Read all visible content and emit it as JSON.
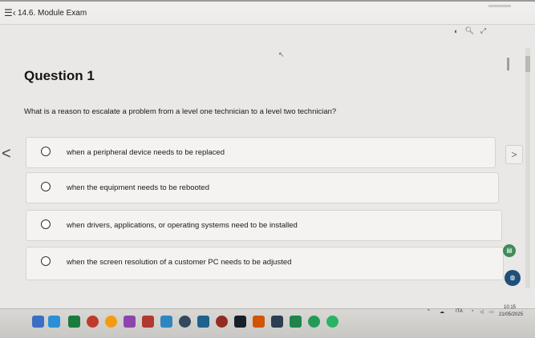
{
  "header": {
    "menu_icon": "menu-list-icon",
    "module_title": "14.6. Module Exam"
  },
  "toolbar": {
    "icons": [
      "moon-icon",
      "search-icon",
      "expand-icon"
    ]
  },
  "question": {
    "heading": "Question 1",
    "text": "What is a reason to escalate a problem from a level one technician to a level two technician?"
  },
  "options": [
    {
      "label": "when a peripheral device needs to be replaced",
      "selected": false
    },
    {
      "label": "when the equipment needs to be rebooted",
      "selected": false
    },
    {
      "label": "when drivers, applications, or operating systems need to be installed",
      "selected": false
    },
    {
      "label": "when the screen resolution of a customer PC needs to be adjusted",
      "selected": false
    }
  ],
  "navigation": {
    "prev_glyph": "<",
    "next_glyph": ">"
  },
  "taskbar": {
    "time": "10:15",
    "date": "21/05/2025",
    "language": "ITA"
  },
  "colors": {
    "background": "#e9e8e6",
    "option_background": "#f4f3f1",
    "taskbar": "#c8c7c4"
  }
}
